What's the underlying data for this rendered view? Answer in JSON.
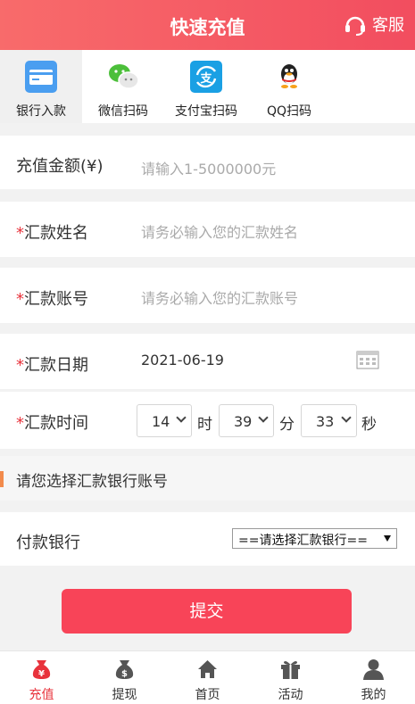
{
  "header": {
    "title": "快速充值",
    "service_label": "客服"
  },
  "tabs": [
    {
      "label": "银行入款",
      "icon": "bank-card-icon",
      "active": true
    },
    {
      "label": "微信扫码",
      "icon": "wechat-icon",
      "active": false
    },
    {
      "label": "支付宝扫码",
      "icon": "alipay-icon",
      "active": false
    },
    {
      "label": "QQ扫码",
      "icon": "qq-penguin-icon",
      "active": false
    }
  ],
  "form": {
    "amount": {
      "label": "充值金额(¥)",
      "placeholder": "请输入1-5000000元"
    },
    "name": {
      "required": "*",
      "label": "汇款姓名",
      "placeholder": "请务必输入您的汇款姓名"
    },
    "account": {
      "required": "*",
      "label": "汇款账号",
      "placeholder": "请务必输入您的汇款账号"
    },
    "date": {
      "required": "*",
      "label": "汇款日期",
      "value": "2021-06-19"
    },
    "time": {
      "required": "*",
      "label": "汇款时间",
      "hour": "14",
      "hour_unit": "时",
      "minute": "39",
      "minute_unit": "分",
      "second": "33",
      "second_unit": "秒"
    }
  },
  "bank_section": {
    "title": "请您选择汇款银行账号",
    "pay_bank_label": "付款银行",
    "pay_bank_selected": "==请选择汇款银行=="
  },
  "submit_label": "提交",
  "bottom_nav": [
    {
      "label": "充值",
      "icon": "money-bag-icon",
      "active": true
    },
    {
      "label": "提现",
      "icon": "withdraw-bag-icon",
      "active": false
    },
    {
      "label": "首页",
      "icon": "home-icon",
      "active": false
    },
    {
      "label": "活动",
      "icon": "gift-icon",
      "active": false
    },
    {
      "label": "我的",
      "icon": "user-icon",
      "active": false
    }
  ],
  "colors": {
    "accent": "#f24d5f",
    "active_nav": "#e8333c",
    "section_bar": "#f28b4c"
  }
}
